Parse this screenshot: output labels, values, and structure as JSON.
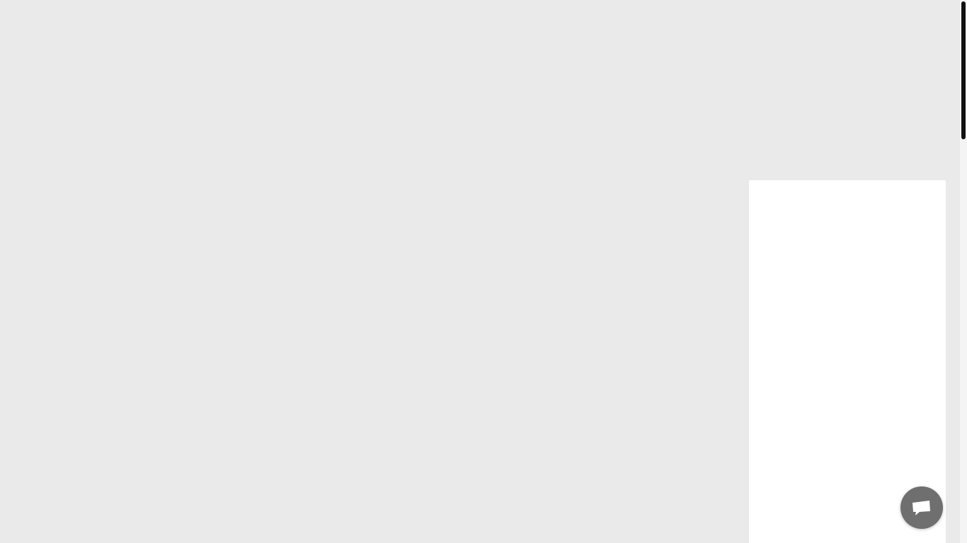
{
  "page": {
    "background_color": "#eaeaea",
    "panel_color": "#ffffff"
  },
  "scrollbar": {
    "thumb_color": "#111111",
    "scroll_fraction": 0.0
  },
  "chat_widget": {
    "icon": "chat-bubble-icon",
    "color": "#6f6f6f"
  }
}
